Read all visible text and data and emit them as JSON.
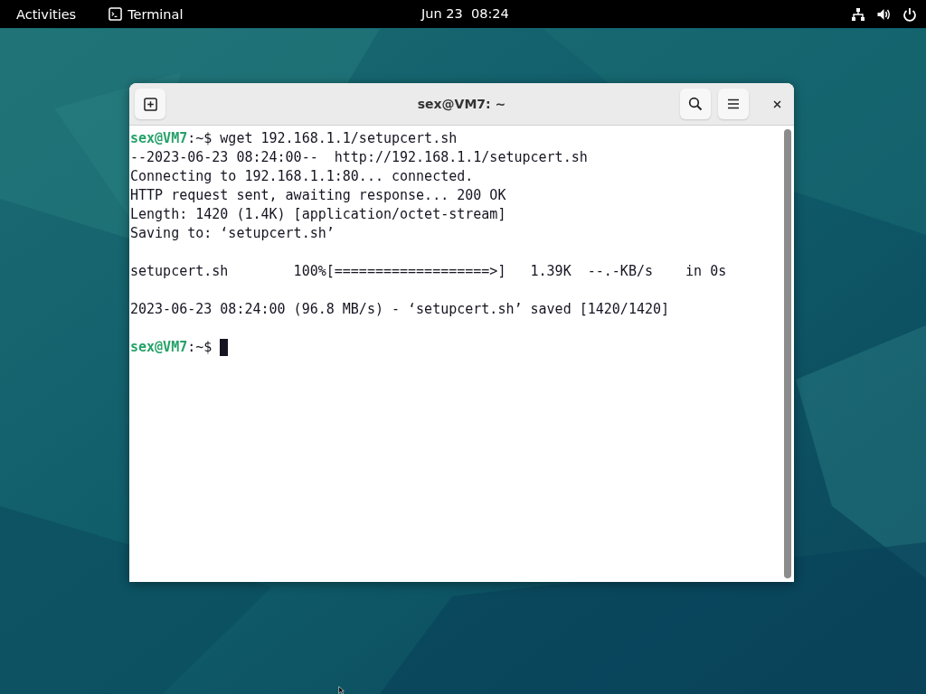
{
  "top_bar": {
    "activities": "Activities",
    "app_name": "Terminal",
    "clock": "Jun 23  08:24"
  },
  "window": {
    "title": "sex@VM7: ~"
  },
  "terminal": {
    "lines": [
      {
        "kind": "prompt",
        "user": "sex@VM7",
        "path": ":~$",
        "command": "wget 192.168.1.1/setupcert.sh"
      },
      {
        "kind": "text",
        "text": "--2023-06-23 08:24:00--  http://192.168.1.1/setupcert.sh"
      },
      {
        "kind": "text",
        "text": "Connecting to 192.168.1.1:80... connected."
      },
      {
        "kind": "text",
        "text": "HTTP request sent, awaiting response... 200 OK"
      },
      {
        "kind": "text",
        "text": "Length: 1420 (1.4K) [application/octet-stream]"
      },
      {
        "kind": "text",
        "text": "Saving to: ‘setupcert.sh’"
      },
      {
        "kind": "blank"
      },
      {
        "kind": "text",
        "text": "setupcert.sh        100%[===================>]   1.39K  --.-KB/s    in 0s"
      },
      {
        "kind": "blank"
      },
      {
        "kind": "text",
        "text": "2023-06-23 08:24:00 (96.8 MB/s) - ‘setupcert.sh’ saved [1420/1420]"
      },
      {
        "kind": "blank"
      },
      {
        "kind": "prompt",
        "user": "sex@VM7",
        "path": ":~$",
        "cursor": true
      }
    ]
  }
}
